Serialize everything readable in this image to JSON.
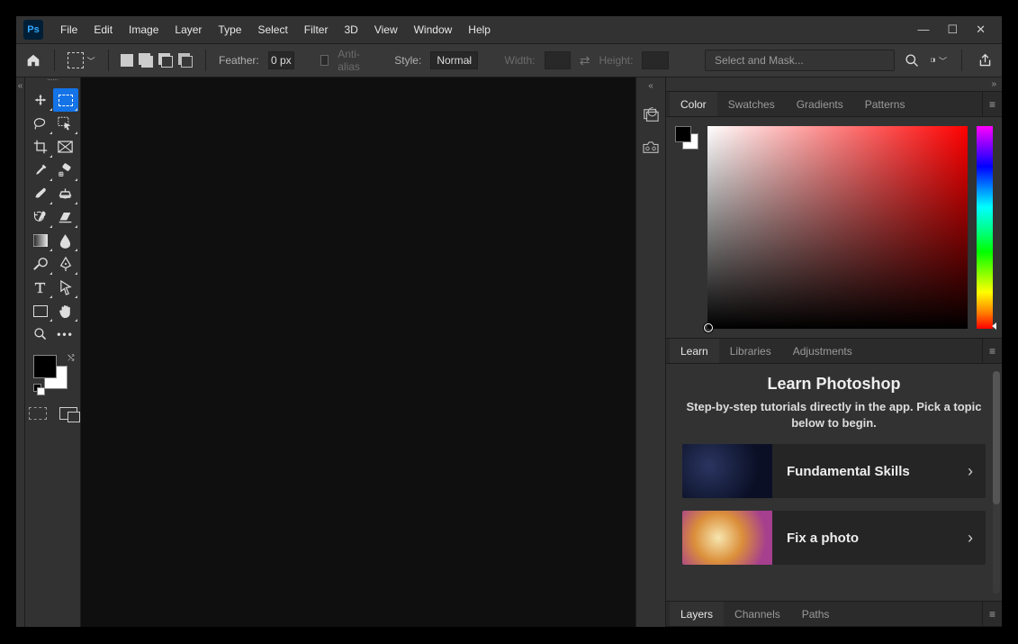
{
  "menubar": {
    "items": [
      "File",
      "Edit",
      "Image",
      "Layer",
      "Type",
      "Select",
      "Filter",
      "3D",
      "View",
      "Window",
      "Help"
    ]
  },
  "optionsbar": {
    "feather_label": "Feather:",
    "feather_value": "0 px",
    "antialias_label": "Anti-alias",
    "style_label": "Style:",
    "style_value": "Normal",
    "width_label": "Width:",
    "width_value": "",
    "height_label": "Height:",
    "height_value": "",
    "mask_button": "Select and Mask..."
  },
  "color_tabs": [
    "Color",
    "Swatches",
    "Gradients",
    "Patterns"
  ],
  "color_active": "Color",
  "learn_tabs": [
    "Learn",
    "Libraries",
    "Adjustments"
  ],
  "learn_active": "Learn",
  "learn": {
    "title": "Learn Photoshop",
    "subtitle": "Step-by-step tutorials directly in the app. Pick a topic below to begin.",
    "cards": [
      {
        "title": "Fundamental Skills"
      },
      {
        "title": "Fix a photo"
      }
    ]
  },
  "layers_tabs": [
    "Layers",
    "Channels",
    "Paths"
  ],
  "layers_active": "Layers",
  "colors": {
    "fg": "#000000",
    "bg": "#ffffff"
  }
}
